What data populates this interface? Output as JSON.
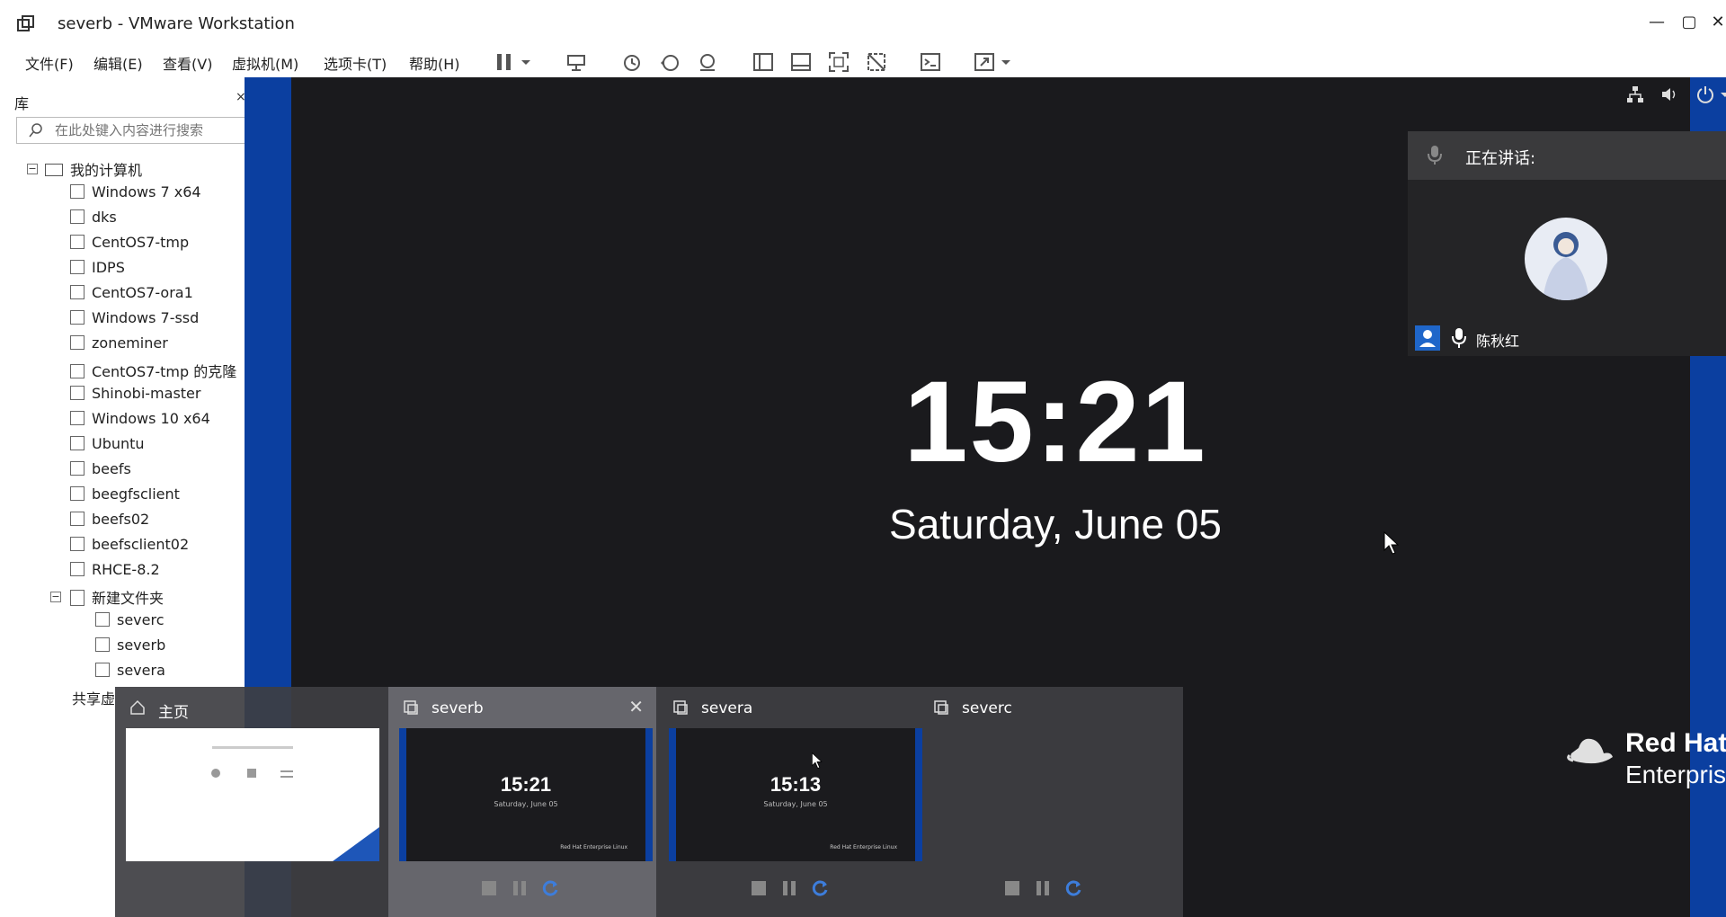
{
  "window": {
    "title": "severb - VMware Workstation",
    "minimize_glyph": "—",
    "maximize_glyph": "▢",
    "close_glyph": "✕"
  },
  "menu": {
    "items": [
      "文件(F)",
      "编辑(E)",
      "查看(V)",
      "虚拟机(M)",
      "选项卡(T)",
      "帮助(H)"
    ]
  },
  "toolbar": {
    "icons": [
      "pause-icon",
      "dropdown-icon",
      "send-ctrl-alt-del-icon",
      "snapshot-icon",
      "revert-snapshot-icon",
      "snapshot-manager-icon",
      "library-view-icon",
      "thumbnail-bar-icon",
      "fullscreen-icon",
      "unity-icon",
      "console-icon",
      "stretch-icon",
      "dropdown-icon"
    ]
  },
  "library": {
    "title": "库",
    "close_glyph": "×",
    "search_placeholder": "在此处键入内容进行搜索",
    "root": "我的计算机",
    "vms": [
      "Windows 7 x64",
      "dks",
      "CentOS7-tmp",
      "IDPS",
      "CentOS7-ora1",
      "Windows 7-ssd",
      "zoneminer",
      "CentOS7-tmp 的克隆",
      "Shinobi-master",
      "Windows 10 x64",
      "Ubuntu",
      "beefs",
      "beegfsclient",
      "beefs02",
      "beefsclient02",
      "RHCE-8.2"
    ],
    "folder": "新建文件夹",
    "folder_vms": [
      "severc",
      "severb",
      "severa"
    ],
    "shared": "共享虚"
  },
  "vm": {
    "time": "15:21",
    "date": "Saturday, June 05",
    "brand_line1": "Red Hat",
    "brand_line2": "Enterprise Linux",
    "accent_color": "#0b3fa0"
  },
  "speaking": {
    "label": "正在讲话:",
    "speaker_name": "陈秋红"
  },
  "switcher": {
    "tabs": [
      {
        "label": "主页",
        "kind": "home"
      },
      {
        "label": "severb",
        "kind": "vm",
        "time": "15:21",
        "date": "Saturday, June 05",
        "logo": "Red Hat Enterprise Linux",
        "close_glyph": "✕"
      },
      {
        "label": "severa",
        "kind": "vm",
        "time": "15:13",
        "date": "Saturday, June 05",
        "logo": "Red Hat Enterprise Linux"
      },
      {
        "label": "severc",
        "kind": "vm-off"
      }
    ]
  }
}
